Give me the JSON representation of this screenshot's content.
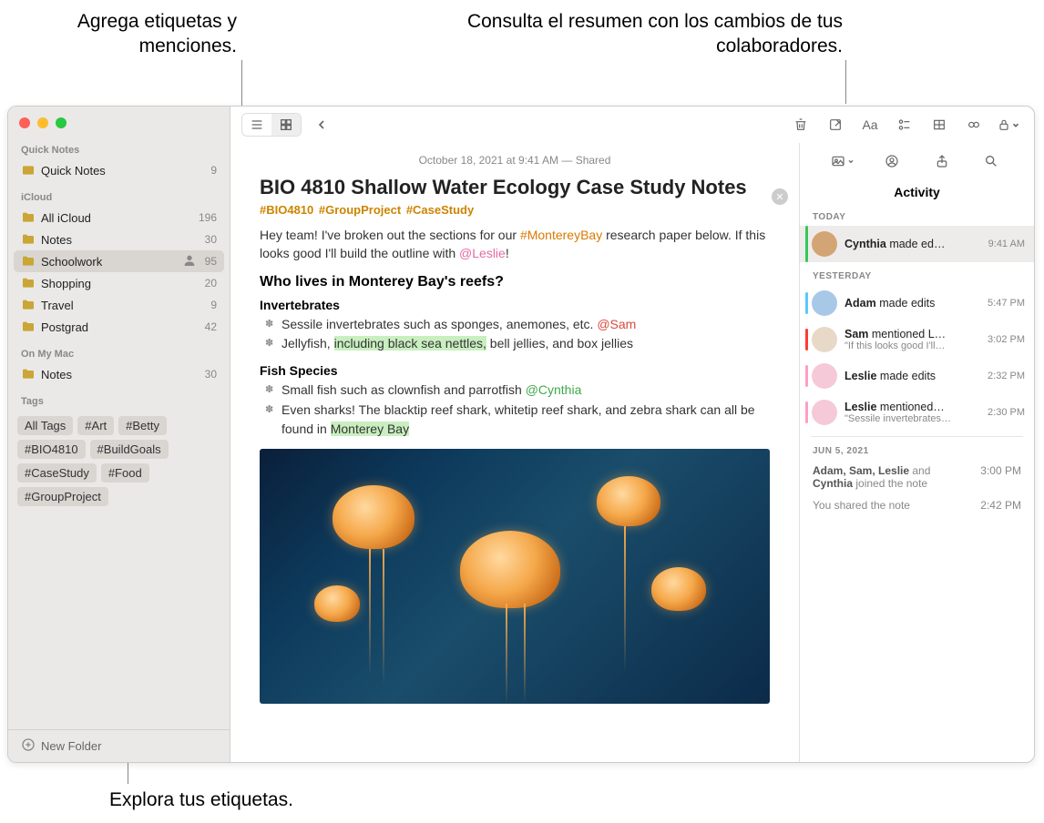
{
  "callouts": {
    "top_left": "Agrega etiquetas y menciones.",
    "top_right": "Consulta el resumen con los cambios de tus colaboradores.",
    "bottom_left": "Explora tus etiquetas."
  },
  "sidebar": {
    "quick_notes_hdr": "Quick Notes",
    "quick_notes": {
      "label": "Quick Notes",
      "count": "9"
    },
    "icloud_hdr": "iCloud",
    "icloud_items": [
      {
        "label": "All iCloud",
        "count": "196"
      },
      {
        "label": "Notes",
        "count": "30"
      },
      {
        "label": "Schoolwork",
        "count": "95",
        "shared": true
      },
      {
        "label": "Shopping",
        "count": "20"
      },
      {
        "label": "Travel",
        "count": "9"
      },
      {
        "label": "Postgrad",
        "count": "42"
      }
    ],
    "onmymac_hdr": "On My Mac",
    "onmymac_items": [
      {
        "label": "Notes",
        "count": "30"
      }
    ],
    "tags_hdr": "Tags",
    "tags": [
      "All Tags",
      "#Art",
      "#Betty",
      "#BIO4810",
      "#BuildGoals",
      "#CaseStudy",
      "#Food",
      "#GroupProject"
    ],
    "new_folder": "New Folder"
  },
  "note": {
    "meta": "October 18, 2021 at 9:41 AM — Shared",
    "title": "BIO 4810 Shallow Water Ecology Case Study Notes",
    "hashtags": [
      "#BIO4810",
      "#GroupProject",
      "#CaseStudy"
    ],
    "intro_1": "Hey team! I've broken out the sections for our ",
    "intro_tag": "#MontereyBay",
    "intro_2": " research paper below. If this looks good I'll build the outline with ",
    "intro_mention": "@Leslie",
    "intro_3": "!",
    "h2": "Who lives in Monterey Bay's reefs?",
    "h3a": "Invertebrates",
    "inv_1a": "Sessile invertebrates such as sponges, anemones, etc. ",
    "inv_1b": "@Sam",
    "inv_2a": "Jellyfish, ",
    "inv_2b": "including black sea nettles,",
    "inv_2c": " bell jellies, and box jellies",
    "h3b": "Fish Species",
    "fish_1a": "Small fish such as clownfish and parrotfish ",
    "fish_1b": "@Cynthia",
    "fish_2a": "Even sharks! The blacktip reef shark, whitetip reef shark, and zebra shark can all be found in ",
    "fish_2b": "Monterey Bay"
  },
  "activity": {
    "title": "Activity",
    "sections": {
      "today": "TODAY",
      "yesterday": "YESTERDAY",
      "older": "JUN 5, 2021"
    },
    "today_items": [
      {
        "actor": "Cynthia",
        "rest": " made ed…",
        "time": "9:41 AM",
        "accent": "#34c759",
        "avatar": "#d4a574"
      }
    ],
    "yesterday_items": [
      {
        "actor": "Adam",
        "rest": " made edits",
        "time": "5:47 PM",
        "accent": "#5ac8fa",
        "avatar": "#a8c8e8"
      },
      {
        "actor": "Sam",
        "rest": " mentioned L…",
        "sub": "\"If this looks good I'll…",
        "time": "3:02 PM",
        "accent": "#ff3b30",
        "avatar": "#e8d8c8"
      },
      {
        "actor": "Leslie",
        "rest": " made edits",
        "time": "2:32 PM",
        "accent": "#ff9ec7",
        "avatar": "#f5c9d8"
      },
      {
        "actor": "Leslie",
        "rest": " mentioned…",
        "sub": "\"Sessile invertebrates…",
        "time": "2:30 PM",
        "accent": "#ff9ec7",
        "avatar": "#f5c9d8"
      }
    ],
    "older_1_a": "Adam, Sam, Leslie",
    "older_1_b": " and ",
    "older_1_c": "Cynthia",
    "older_1_d": " joined the note",
    "older_1_time": "3:00 PM",
    "older_2": "You shared the note",
    "older_2_time": "2:42 PM"
  }
}
